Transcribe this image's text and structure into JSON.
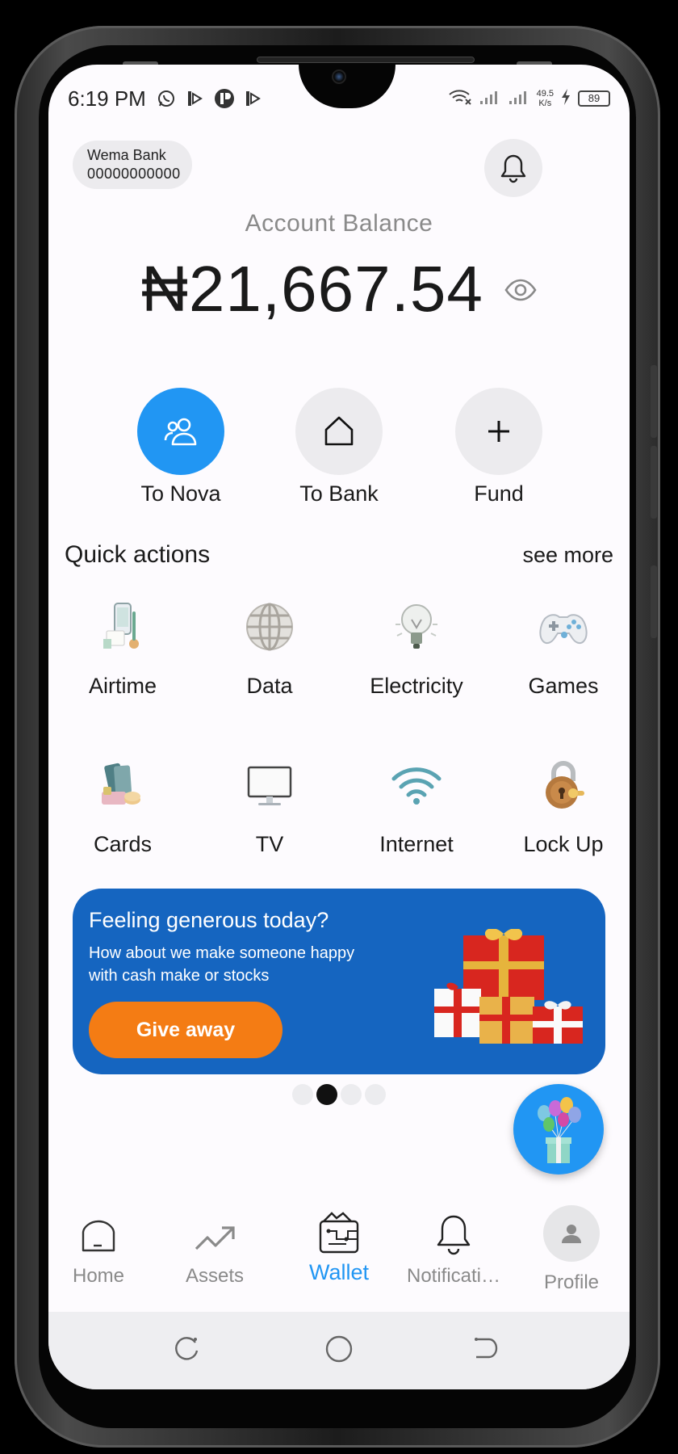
{
  "status_bar": {
    "time": "6:19 PM",
    "speed_value": "49.5",
    "speed_unit": "K/s",
    "battery": "89"
  },
  "header": {
    "bank_name": "Wema Bank",
    "account_number": "00000000000"
  },
  "balance": {
    "label": "Account Balance",
    "amount": "₦21,667.54"
  },
  "main_actions": [
    {
      "label": "To Nova",
      "icon": "users-icon"
    },
    {
      "label": "To Bank",
      "icon": "home-icon"
    },
    {
      "label": "Fund",
      "icon": "plus-icon"
    }
  ],
  "quick_actions": {
    "title": "Quick actions",
    "see_more": "see more",
    "items": [
      {
        "label": "Airtime",
        "icon": "phone-airtime-icon"
      },
      {
        "label": "Data",
        "icon": "globe-icon"
      },
      {
        "label": "Electricity",
        "icon": "bulb-icon"
      },
      {
        "label": "Games",
        "icon": "gamepad-icon"
      },
      {
        "label": "Cards",
        "icon": "cards-icon"
      },
      {
        "label": "TV",
        "icon": "tv-icon"
      },
      {
        "label": "Internet",
        "icon": "wifi-icon"
      },
      {
        "label": "Lock Up",
        "icon": "padlock-icon"
      }
    ]
  },
  "banner": {
    "title": "Feeling generous today?",
    "subtitle": "How about we make someone happy with cash make or stocks",
    "button": "Give away",
    "background": "#1565c0",
    "button_color": "#f47c14"
  },
  "carousel": {
    "pages": 4,
    "active_index": 1
  },
  "bottom_nav": [
    {
      "label": "Home",
      "icon": "home-icon",
      "active": false
    },
    {
      "label": "Assets",
      "icon": "trending-up-icon",
      "active": false
    },
    {
      "label": "Wallet",
      "icon": "wallet-icon",
      "active": true
    },
    {
      "label": "Notificati…",
      "icon": "bell-icon",
      "active": false
    },
    {
      "label": "Profile",
      "icon": "person-icon",
      "active": false
    }
  ],
  "colors": {
    "accent": "#2196f3",
    "background": "#fdfbfe"
  }
}
